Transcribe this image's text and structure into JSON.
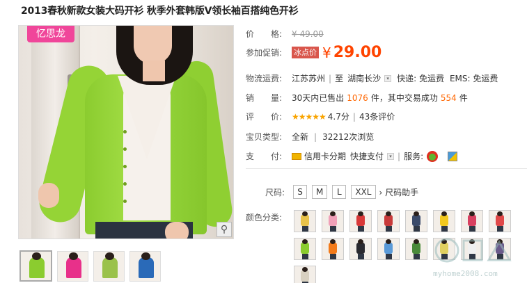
{
  "product": {
    "title": "2013春秋新款女装大码开衫 秋季外套韩版V领长袖百搭纯色开衫",
    "brand_tag": "忆思龙"
  },
  "price": {
    "label": "价　　格:",
    "original": "¥ 49.00",
    "promo_label": "参加促销:",
    "promo_tag": "冰点价",
    "currency": "¥",
    "current": "29.00"
  },
  "shipping": {
    "label": "物流运费:",
    "from": "江苏苏州",
    "to_prefix": "至",
    "to": "湖南长沙",
    "express": "快递: 免运费",
    "ems": "EMS: 免运费"
  },
  "sales": {
    "label": "销　　量:",
    "prefix": "30天内已售出",
    "sold": "1076",
    "middle": "件，其中交易成功",
    "success": "554",
    "suffix": "件"
  },
  "rating": {
    "label": "评　　价:",
    "stars": "★★★★★",
    "score": "4.7分",
    "reviews": "43条评价"
  },
  "item_type": {
    "label": "宝贝类型:",
    "condition": "全新",
    "views": "32212次浏览"
  },
  "payment": {
    "label": "支　　付:",
    "credit": "信用卡分期",
    "quick": "快捷支付",
    "service_label": "服务:"
  },
  "sizes": {
    "label": "尺码:",
    "options": [
      "S",
      "M",
      "L",
      "XXL"
    ],
    "help": "尺码助手"
  },
  "colors": {
    "label": "颜色分类:",
    "swatches": [
      "#e8c24a",
      "#f0a0b8",
      "#d83838",
      "#c83a3a",
      "#3a4a6a",
      "#f2c81e",
      "#d84060",
      "#e04848",
      "#8bcc2f",
      "#f27a1a",
      "#2a2a30",
      "#5a9ad8",
      "#4a8a3a",
      "#e0d060",
      "#f0f0f0",
      "#6a5a8a",
      "#d8d0c0"
    ]
  },
  "thumbnails": [
    "#8bcc2f",
    "#e8308a",
    "#9ac24a",
    "#2a6ab8"
  ],
  "watermark": "myhome2008.com",
  "icons": {
    "zoom": "magnifier-icon",
    "stars": "star-icon",
    "credit": "credit-card-icon",
    "dropdown": "chevron-down-icon",
    "service": "service-badge-icon"
  }
}
